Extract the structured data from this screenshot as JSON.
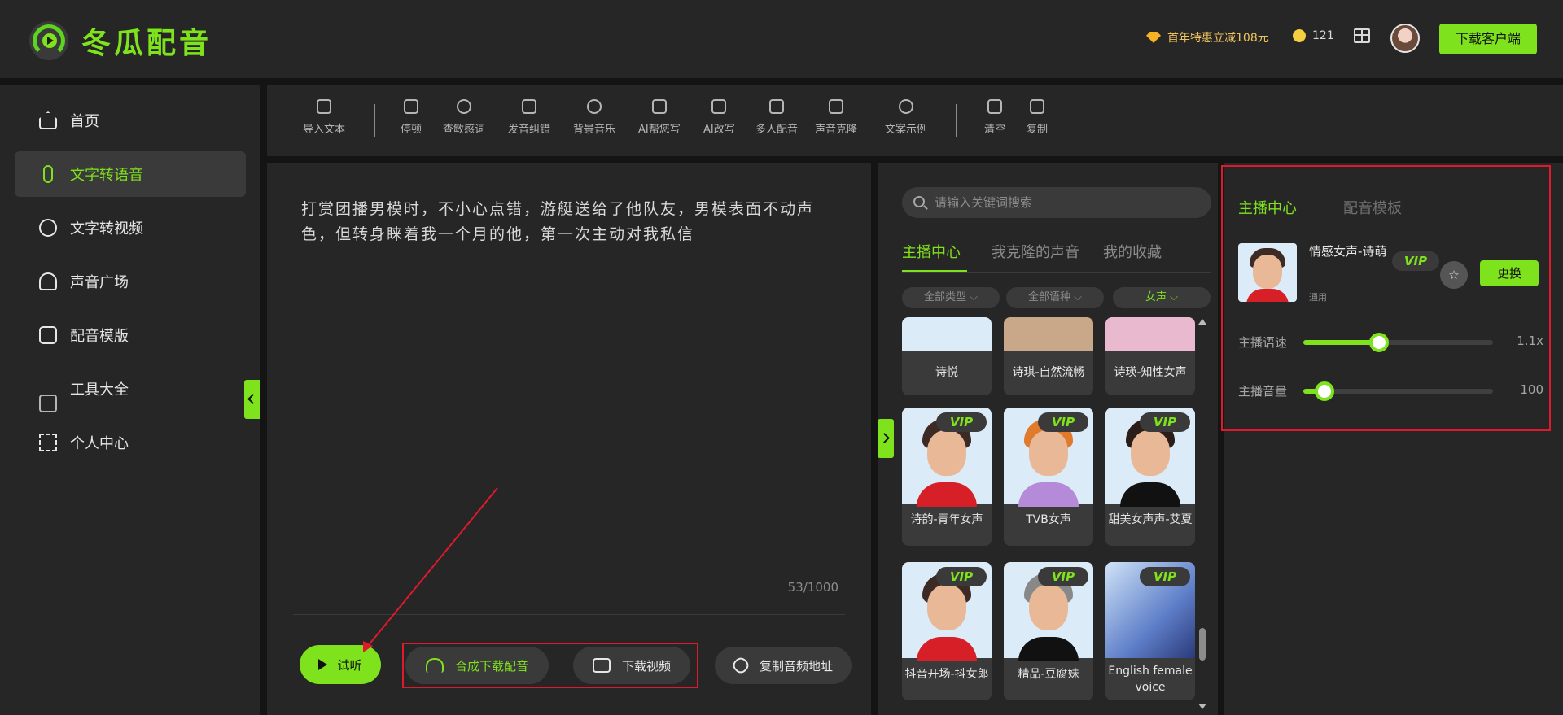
{
  "colors": {
    "accent": "#7ee21c",
    "background": "#262626",
    "highlight_box": "#e0192c"
  },
  "header": {
    "app_name": "冬瓜配音",
    "promo": "首年特惠立减108元",
    "coins": "121",
    "download_client": "下载客户端"
  },
  "sidebar": {
    "items": [
      {
        "label": "首页",
        "icon": "home-icon"
      },
      {
        "label": "文字转语音",
        "icon": "microphone-icon",
        "active": true
      },
      {
        "label": "文字转视频",
        "icon": "bear-icon"
      },
      {
        "label": "声音广场",
        "icon": "people-icon"
      },
      {
        "label": "配音模版",
        "icon": "template-icon"
      },
      {
        "label": "工具大全",
        "icon": "toolbox-icon"
      },
      {
        "label": "个人中心",
        "icon": "grid-icon"
      }
    ]
  },
  "toolbar": {
    "items": [
      "导入文本",
      "停顿",
      "查敏感词",
      "发音纠错",
      "背景音乐",
      "AI帮您写",
      "AI改写",
      "多人配音",
      "声音克隆",
      "文案示例",
      "清空",
      "复制"
    ]
  },
  "editor": {
    "text": "打赏团播男模时，不小心点错，游艇送给了他队友，男模表面不动声色，但转身睐着我一个月的他，第一次主动对我私信",
    "char_count": "53/1000",
    "listen": "试听",
    "synthesize_download": "合成下载配音",
    "download_video": "下载视频",
    "copy_audio_url": "复制音频地址"
  },
  "voices": {
    "search_placeholder": "请输入关键词搜索",
    "tabs": [
      "主播中心",
      "我克隆的声音",
      "我的收藏"
    ],
    "filters": [
      "全部类型",
      "全部语种",
      "女声"
    ],
    "filter_active_index": 2,
    "cards": [
      {
        "name": "诗悦",
        "vip": ""
      },
      {
        "name": "诗琪-自然流畅",
        "vip": ""
      },
      {
        "name": "诗瑛-知性女声",
        "vip": ""
      },
      {
        "name": "诗韵-青年女声",
        "vip": "VIP"
      },
      {
        "name": "TVB女声",
        "vip": "VIP"
      },
      {
        "name": "甜美女声声-艾夏",
        "vip": "VIP"
      },
      {
        "name": "抖音开场-抖女郎",
        "vip": "VIP"
      },
      {
        "name": "精品-豆腐妹",
        "vip": "VIP"
      },
      {
        "name": "English female voice",
        "vip": "VIP"
      }
    ]
  },
  "anchor": {
    "tabs": [
      "主播中心",
      "配音模板"
    ],
    "name": "情感女声-诗萌",
    "tag": "通用",
    "vip": "VIP",
    "change": "更换",
    "speed_label": "主播语速",
    "speed_value": "1.1x",
    "speed_level": 0.4,
    "volume_label": "主播音量",
    "volume_value": "100",
    "volume_level": 0.11
  }
}
